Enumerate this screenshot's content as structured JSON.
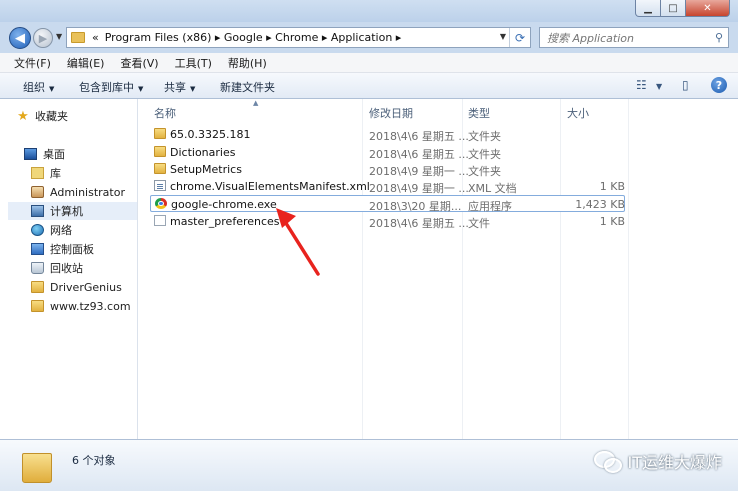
{
  "window": {
    "buttons": {
      "minimize": "▁",
      "maximize": "□",
      "close": "✕"
    }
  },
  "address": {
    "prefix": "«",
    "path": [
      "Program Files (x86)",
      "Google",
      "Chrome",
      "Application"
    ],
    "path_text": "Program Files (x86)  ▸  Google  ▸  Chrome  ▸  Application  ▸"
  },
  "search": {
    "placeholder": "搜索 Application"
  },
  "menu": [
    "文件(F)",
    "编辑(E)",
    "查看(V)",
    "工具(T)",
    "帮助(H)"
  ],
  "toolbar": {
    "organize": "组织",
    "include_in_library": "包含到库中",
    "share": "共享",
    "new_folder": "新建文件夹"
  },
  "nav": {
    "favorites": "收藏夹",
    "desktop": "桌面",
    "library": "库",
    "administrator": "Administrator",
    "computer": "计算机",
    "network": "网络",
    "control_panel": "控制面板",
    "recycle_bin": "回收站",
    "drivergenius": "DriverGenius",
    "tz93": "www.tz93.com"
  },
  "columns": {
    "name": "名称",
    "date": "修改日期",
    "type": "类型",
    "size": "大小"
  },
  "files": [
    {
      "name": "65.0.3325.181",
      "date": "2018\\4\\6 星期五 ...",
      "type": "文件夹",
      "size": "",
      "icon": "folder-icon"
    },
    {
      "name": "Dictionaries",
      "date": "2018\\4\\6 星期五 ...",
      "type": "文件夹",
      "size": "",
      "icon": "folder-icon"
    },
    {
      "name": "SetupMetrics",
      "date": "2018\\4\\9 星期一 ...",
      "type": "文件夹",
      "size": "",
      "icon": "folder-icon"
    },
    {
      "name": "chrome.VisualElementsManifest.xml",
      "date": "2018\\4\\9 星期一 ...",
      "type": "XML 文档",
      "size": "1 KB",
      "icon": "xml-file-icon"
    },
    {
      "name": "google-chrome.exe",
      "date": "2018\\3\\20 星期...",
      "type": "应用程序",
      "size": "1,423 KB",
      "icon": "chrome-icon"
    },
    {
      "name": "master_preferences",
      "date": "2018\\4\\6 星期五 ...",
      "type": "文件",
      "size": "1 KB",
      "icon": "file-icon"
    }
  ],
  "status": {
    "count": "6 个对象"
  },
  "watermark": {
    "text": "IT运维大爆炸"
  },
  "colors": {
    "highlight": "#84acdd",
    "annotation_arrow": "#e8231e",
    "title_bar": "#c9daee"
  }
}
